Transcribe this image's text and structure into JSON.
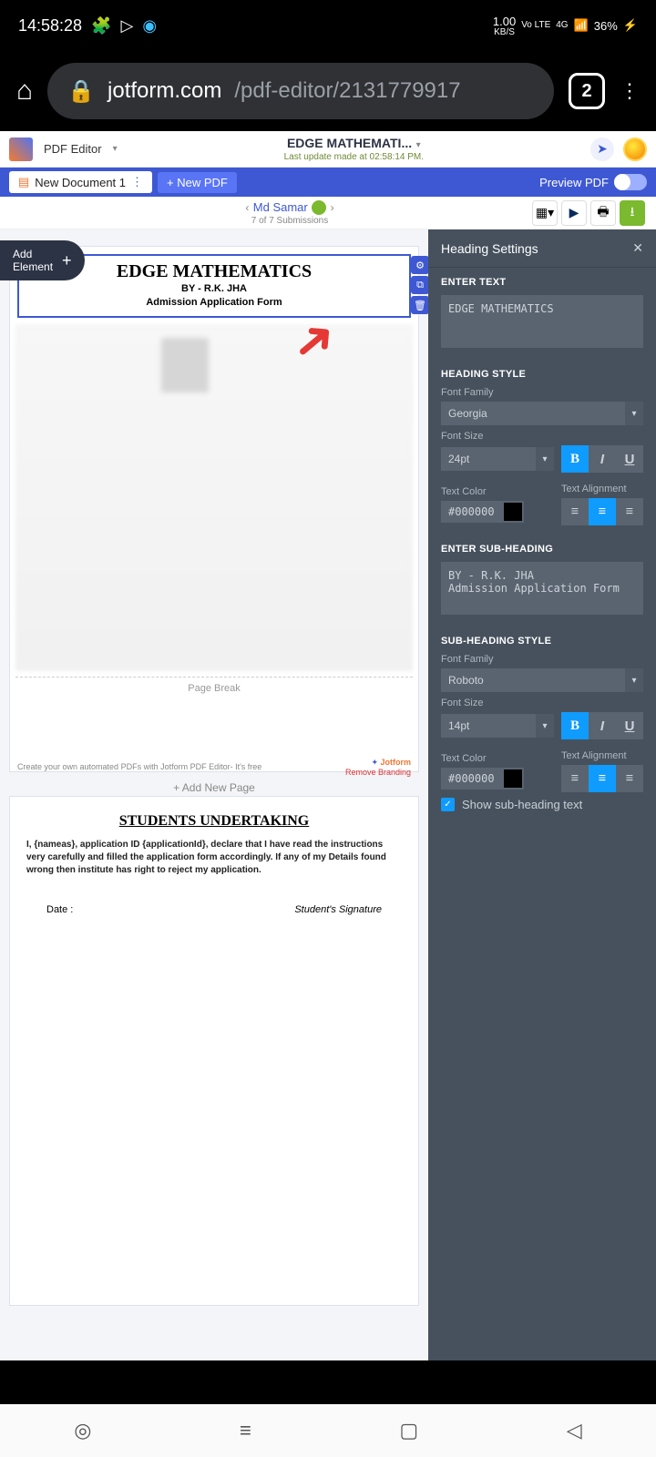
{
  "status": {
    "time": "14:58:28",
    "net_speed": "1.00",
    "net_unit": "KB/S",
    "volte": "Vo LTE",
    "sig": "4G",
    "battery": "36%"
  },
  "browser": {
    "domain": "jotform.com",
    "path": "/pdf-editor/2131779917",
    "tabs": "2"
  },
  "app_top": {
    "editor": "PDF Editor",
    "title": "EDGE MATHEMATI...",
    "subtitle": "Last update made at 02:58:14 PM."
  },
  "sub_bar": {
    "doc": "New Document 1",
    "new_btn": "+ New PDF",
    "preview": "Preview PDF"
  },
  "nav": {
    "name": "Md Samar",
    "counter": "7 of 7 Submissions"
  },
  "add_element": {
    "line1": "Add",
    "line2": "Element"
  },
  "heading": {
    "main": "EDGE MATHEMATICS",
    "sub1": "BY - R.K. JHA",
    "sub2": "Admission Application Form"
  },
  "page_break": "Page Break",
  "footer_left": "Create your own automated PDFs with Jotform PDF Editor- It's free",
  "footer_brand": "Jotform",
  "footer_remove": "Remove Branding",
  "add_page": "+  Add New Page",
  "page2": {
    "title": "STUDENTS UNDERTAKING",
    "body": "I, {nameas}, application ID {applicationId}, declare that I have read the instructions very carefully and filled the application form accordingly. If any of my Details found wrong then institute has right to reject my application.",
    "date": "Date :",
    "sig": "Student's Signature"
  },
  "inspector": {
    "title": "Heading Settings",
    "enter_text": "ENTER TEXT",
    "text_val": "EDGE MATHEMATICS",
    "style_h": "HEADING STYLE",
    "font_family": "Font Family",
    "font_family_val": "Georgia",
    "font_size": "Font Size",
    "font_size_val": "24pt",
    "text_color": "Text Color",
    "color_val": "#000000",
    "alignment": "Text Alignment",
    "enter_sub": "ENTER SUB-HEADING",
    "sub_val": "BY - R.K. JHA\nAdmission Application Form",
    "sub_style_h": "SUB-HEADING STYLE",
    "sub_font_family_val": "Roboto",
    "sub_font_size_val": "14pt",
    "sub_color_val": "#000000",
    "show_sub": "Show sub-heading text"
  }
}
